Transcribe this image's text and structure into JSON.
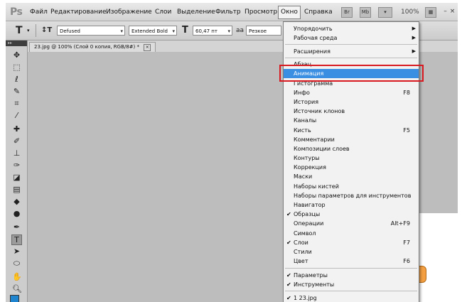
{
  "app": {
    "logo": "Ps"
  },
  "menubar": {
    "items": [
      "Файл",
      "Редактирование",
      "Изображение",
      "Слои",
      "Выделение",
      "Фильтр",
      "Просмотр",
      "Окно",
      "Справка"
    ],
    "icons": [
      "Br",
      "Mb"
    ],
    "zoom": "100%"
  },
  "options": {
    "font_family": "Defused",
    "font_style": "Extended Bold",
    "font_size": "60,47 пт",
    "antialias_icon": "aa",
    "antialias": "Резкое"
  },
  "document": {
    "tab_title": "23.jpg @ 100% (Слой 0 копия, RGB/8#) *"
  },
  "dropdown": {
    "items": [
      {
        "label": "Упорядочить",
        "submenu": true
      },
      {
        "label": "Рабочая среда",
        "submenu": true
      },
      {
        "label": "Расширения",
        "submenu": true
      },
      {
        "label": "Абзац"
      },
      {
        "label": "Анимация",
        "highlighted": true
      },
      {
        "label": "Гистограмма"
      },
      {
        "label": "Инфо",
        "shortcut": "F8"
      },
      {
        "label": "История"
      },
      {
        "label": "Источник клонов"
      },
      {
        "label": "Каналы"
      },
      {
        "label": "Кисть",
        "shortcut": "F5"
      },
      {
        "label": "Комментарии"
      },
      {
        "label": "Композиции слоев"
      },
      {
        "label": "Контуры"
      },
      {
        "label": "Коррекция"
      },
      {
        "label": "Маски"
      },
      {
        "label": "Наборы кистей"
      },
      {
        "label": "Наборы параметров для инструментов"
      },
      {
        "label": "Навигатор"
      },
      {
        "label": "Образцы",
        "checked": true
      },
      {
        "label": "Операции",
        "shortcut": "Alt+F9"
      },
      {
        "label": "Символ"
      },
      {
        "label": "Слои",
        "shortcut": "F7",
        "checked": true
      },
      {
        "label": "Стили"
      },
      {
        "label": "Цвет",
        "shortcut": "F6"
      },
      {
        "label": "Параметры",
        "checked": true
      },
      {
        "label": "Инструменты",
        "checked": true
      },
      {
        "label": "1 23.jpg",
        "checked": true
      }
    ]
  },
  "colors": {
    "highlight": "#3b8fe2",
    "annotation": "#d8191f",
    "foreground": "#1f84d0"
  }
}
